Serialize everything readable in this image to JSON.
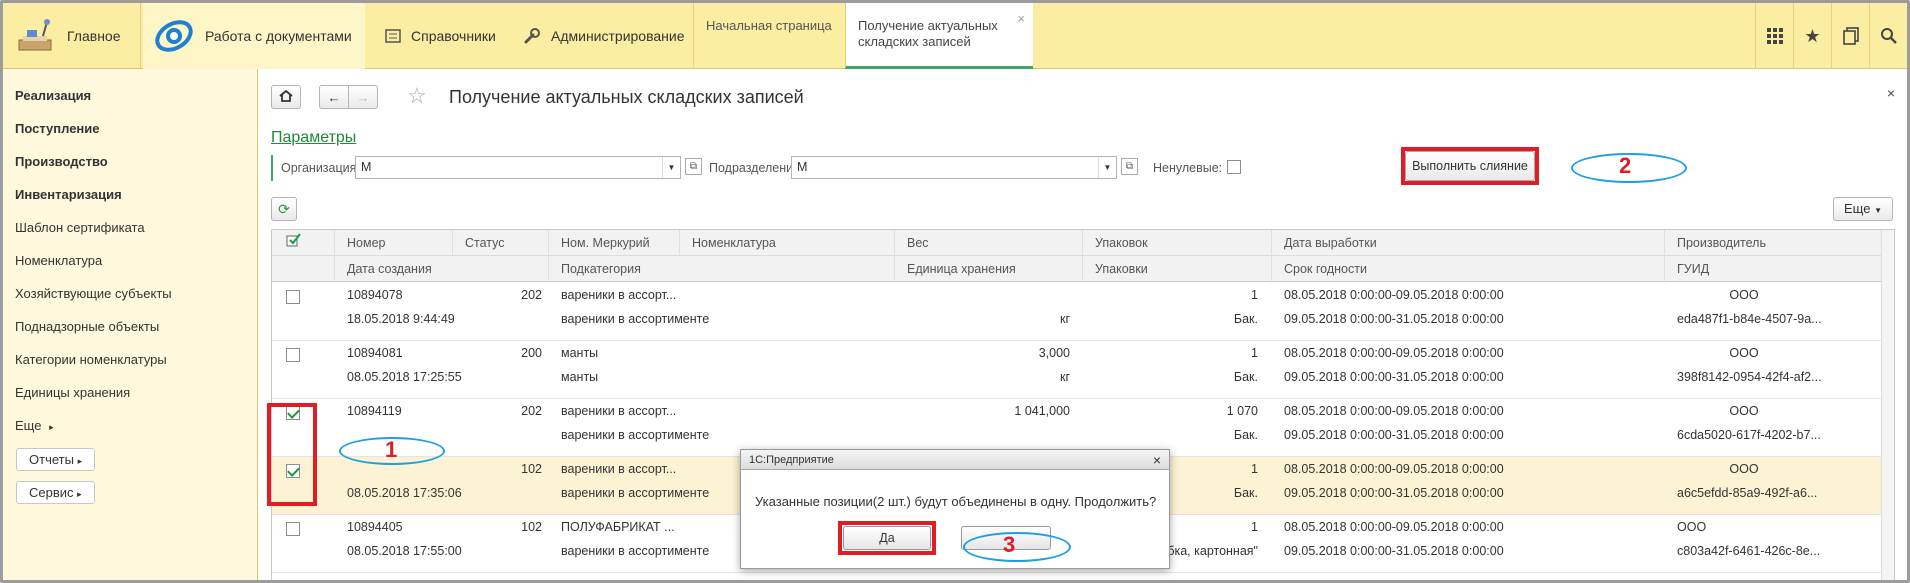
{
  "topbar": {
    "home_label": "Главное",
    "sections": [
      {
        "label": "Работа с документами",
        "icon": "doc-work-icon"
      },
      {
        "label": "Справочники",
        "icon": "catalog-icon"
      },
      {
        "label": "Администрирование",
        "icon": "wrench-icon"
      }
    ],
    "tabs": [
      {
        "label": "Начальная страница"
      },
      {
        "label": "Получение актуальных складских записей"
      }
    ],
    "tab_close": "×",
    "tools": [
      "apps-icon",
      "star-icon",
      "history-icon",
      "search-icon"
    ]
  },
  "sidebar": {
    "items": [
      {
        "label": "Реализация",
        "bold": true
      },
      {
        "label": "Поступление",
        "bold": true
      },
      {
        "label": "Производство",
        "bold": true
      },
      {
        "label": "Инвентаризация",
        "bold": true
      },
      {
        "label": "Шаблон сертификата",
        "bold": false
      },
      {
        "label": "Номенклатура",
        "bold": false
      },
      {
        "label": "Хозяйствующие субъекты",
        "bold": false
      },
      {
        "label": "Поднадзорные объекты",
        "bold": false
      },
      {
        "label": "Категории номенклатуры",
        "bold": false
      },
      {
        "label": "Единицы хранения",
        "bold": false
      }
    ],
    "more_label": "Еще",
    "reports_label": "Отчеты",
    "service_label": "Сервис"
  },
  "form": {
    "title": "Получение актуальных складских записей",
    "params_link": "Параметры",
    "org_label": "Организация:",
    "org_value": "М",
    "dept_label": "Подразделение:",
    "dept_value": "М",
    "nonzero_label": "Ненулевые:",
    "merge_button": "Выполнить слияние",
    "more_button": "Еще",
    "close": "×"
  },
  "table": {
    "header_row1": [
      "Номер",
      "Статус",
      "Ном. Меркурий",
      "Номенклатура",
      "Вес",
      "Упаковок",
      "Дата выработки",
      "Производитель"
    ],
    "header_row2": [
      "Дата создания",
      "Подкатегория",
      "Единица хранения",
      "Упаковки",
      "Срок годности",
      "ГУИД"
    ],
    "rows": [
      {
        "checked": false,
        "num": "10894078",
        "status": "202",
        "merc": "вареники в ассорт...",
        "weight": "",
        "packs": "1",
        "prod_date": "08.05.2018 0:00:00-09.05.2018 0:00:00",
        "maker": "ООО",
        "created": "18.05.2018 9:44:49",
        "subcat": "вареники в ассортименте",
        "unit": "кг",
        "pack": "Бак.",
        "expiry": "09.05.2018 0:00:00-31.05.2018 0:00:00",
        "guid": "eda487f1-b84e-4507-9a..."
      },
      {
        "checked": false,
        "num": "10894081",
        "status": "200",
        "merc": "манты",
        "weight": "3,000",
        "packs": "1",
        "prod_date": "08.05.2018 0:00:00-09.05.2018 0:00:00",
        "maker": "ООО",
        "created": "08.05.2018 17:25:55",
        "subcat": "манты",
        "unit": "кг",
        "pack": "Бак.",
        "expiry": "09.05.2018 0:00:00-31.05.2018 0:00:00",
        "guid": "398f8142-0954-42f4-af2..."
      },
      {
        "checked": true,
        "num": "10894119",
        "status": "202",
        "merc": "вареники в ассорт...",
        "weight": "1 041,000",
        "packs": "1 070",
        "prod_date": "08.05.2018 0:00:00-09.05.2018 0:00:00",
        "maker": "ООО",
        "created": "",
        "subcat": "вареники в ассортименте",
        "unit": "",
        "pack": "Бак.",
        "expiry": "09.05.2018 0:00:00-31.05.2018 0:00:00",
        "guid": "6cda5020-617f-4202-b7..."
      },
      {
        "checked": true,
        "num": "",
        "status": "102",
        "merc": "вареники в ассорт...",
        "weight": "",
        "packs": "1",
        "prod_date": "08.05.2018 0:00:00-09.05.2018 0:00:00",
        "maker": "ООО",
        "created": "08.05.2018 17:35:06",
        "subcat": "вареники в ассортименте",
        "unit": "",
        "pack": "Бак.",
        "expiry": "09.05.2018 0:00:00-31.05.2018 0:00:00",
        "guid": "a6c5efdd-85a9-492f-a6..."
      },
      {
        "checked": false,
        "num": "10894405",
        "status": "102",
        "merc": "ПОЛУФАБРИКАТ ...",
        "weight": "",
        "packs": "1",
        "prod_date": "08.05.2018 0:00:00-09.05.2018 0:00:00",
        "maker": "ООО",
        "created": "08.05.2018 17:55:00",
        "subcat": "вареники в ассортименте",
        "unit": "",
        "pack": "коробка, картонная\"",
        "expiry": "09.05.2018 0:00:00-31.05.2018 0:00:00",
        "guid": "c803a42f-6461-426c-8e..."
      }
    ]
  },
  "dialog": {
    "title": "1С:Предприятие",
    "message": "Указанные позиции(2 шт.) будут объединены в одну. Продолжить?",
    "yes": "Да",
    "no": "",
    "close": "×"
  },
  "annotations": {
    "one": "1",
    "two": "2",
    "three": "3",
    "red": "#e01c24",
    "blue": "#1d9fe0"
  }
}
